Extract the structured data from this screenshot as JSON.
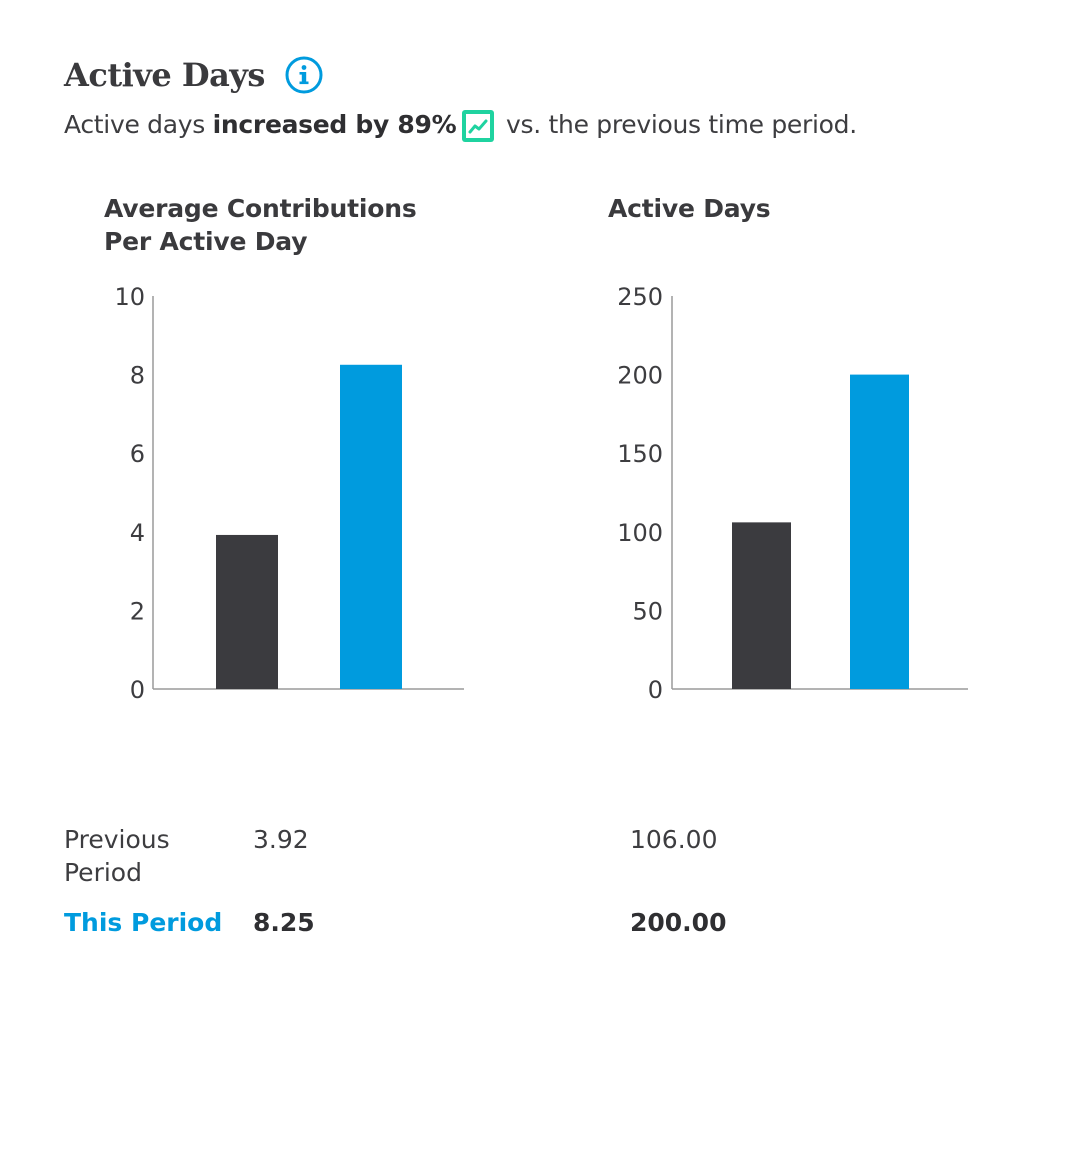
{
  "header": {
    "title": "Active Days",
    "summary_prefix": "Active days ",
    "summary_bold": "increased by 89%",
    "summary_suffix": " vs. the previous time period."
  },
  "icons": {
    "info": "info-icon",
    "trend": "trend-up-icon"
  },
  "colors": {
    "previous": "#3b3b3f",
    "current": "#009bde",
    "trend_icon_bg": "#1fd3a0"
  },
  "chart_data": [
    {
      "type": "bar",
      "title": "Average Contributions Per Active Day",
      "categories": [
        "Previous Period",
        "This Period"
      ],
      "values": [
        3.92,
        8.25
      ],
      "ylim": [
        0,
        10
      ],
      "yticks": [
        "0",
        "2",
        "4",
        "6",
        "8",
        "10"
      ],
      "grid": false
    },
    {
      "type": "bar",
      "title": "Active Days",
      "categories": [
        "Previous Period",
        "This Period"
      ],
      "values": [
        106.0,
        200.0
      ],
      "ylim": [
        0,
        250
      ],
      "yticks": [
        "0",
        "50",
        "100",
        "150",
        "200",
        "250"
      ],
      "grid": false
    }
  ],
  "stats": {
    "previous_label": "Previous Period",
    "this_label": "This Period",
    "chart1": {
      "previous": "3.92",
      "this": "8.25"
    },
    "chart2": {
      "previous": "106.00",
      "this": "200.00"
    }
  }
}
